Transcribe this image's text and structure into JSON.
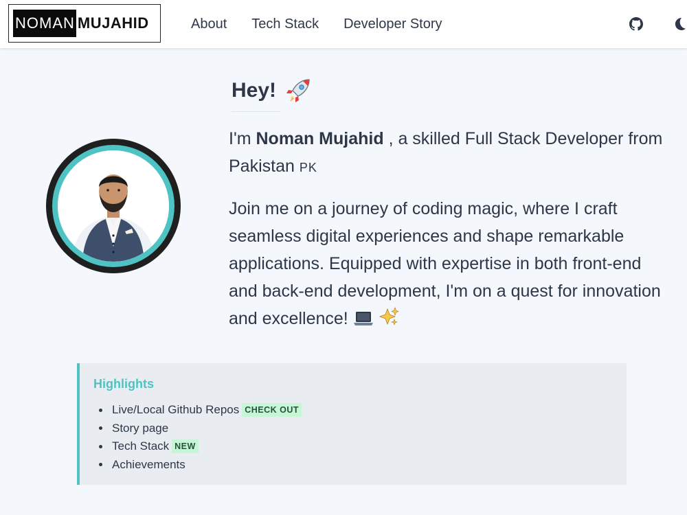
{
  "header": {
    "logo_first": "NOMAN",
    "logo_last": "MUJAHID",
    "nav": [
      "About",
      "Tech Stack",
      "Developer Story"
    ],
    "icons": [
      "github-icon",
      "moon-icon"
    ]
  },
  "hero": {
    "greeting": "Hey!",
    "intro_prefix": "I'm",
    "name": "Noman Mujahid",
    "intro_suffix": ", a skilled Full Stack Developer from Pakistan",
    "country_code": "PK",
    "about": "Join me on a journey of coding magic, where I craft seamless digital experiences and shape remarkable applications. Equipped with expertise in both front-end and back-end development, I'm on a quest for innovation and excellence!"
  },
  "highlights": {
    "title": "Highlights",
    "items": [
      {
        "label": "Live/Local Github Repos",
        "badge": "CHECK OUT"
      },
      {
        "label": "Story page",
        "badge": ""
      },
      {
        "label": "Tech Stack",
        "badge": "NEW"
      },
      {
        "label": "Achievements",
        "badge": ""
      }
    ]
  },
  "colors": {
    "accent": "#4fc3c3",
    "text": "#2d3748",
    "badge_bg": "#c6f6d5",
    "background": "#f4f7fb"
  }
}
